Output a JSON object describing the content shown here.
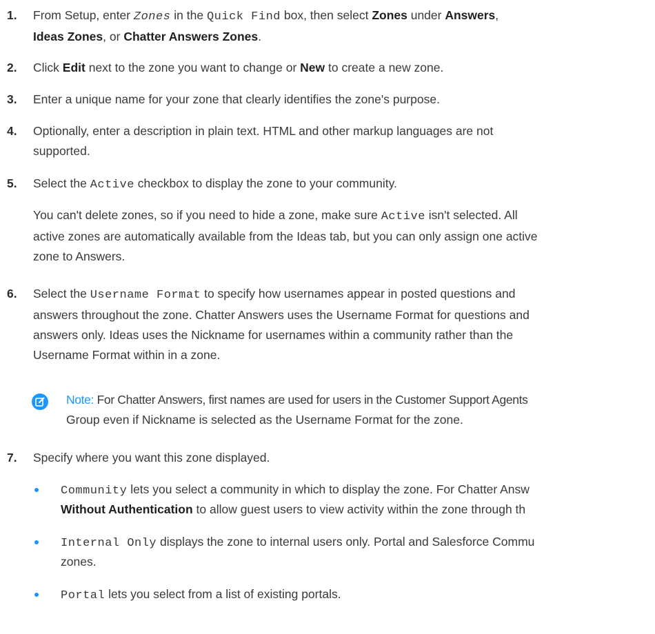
{
  "steps": [
    {
      "num": "1.",
      "t1": "From Setup, enter ",
      "c1": "Zones",
      "t2": " in the ",
      "c2": "Quick Find",
      "t3": " box, then select ",
      "b1": "Zones",
      "t4": " under ",
      "b2": "Answers",
      "t5": ",",
      "b3": "Ideas Zones",
      "t6": ", or ",
      "b4": "Chatter Answers Zones",
      "t7": "."
    },
    {
      "num": "2.",
      "t1": "Click ",
      "b1": "Edit",
      "t2": " next to the zone you want to change or ",
      "b2": "New",
      "t3": " to create a new zone."
    },
    {
      "num": "3.",
      "text": "Enter a unique name for your zone that clearly identifies the zone's purpose."
    },
    {
      "num": "4.",
      "line1": "Optionally, enter a description in plain text. HTML and other markup languages are not",
      "line2": "supported."
    },
    {
      "num": "5.",
      "t1": "Select the ",
      "c1": "Active",
      "t2": " checkbox to display the zone to your community.",
      "p1": "You can't delete zones, so if you need to hide a zone, make sure ",
      "pc": "Active",
      "p2": " isn't selected. All",
      "p3": "active zones are automatically available from the Ideas tab, but you can only assign one active",
      "p4": "zone to Answers."
    },
    {
      "num": "6.",
      "t1": "Select the ",
      "c1": "Username Format",
      "t2": " to specify how usernames appear in posted questions and",
      "l2": "answers throughout the zone. Chatter Answers uses the Username Format for questions and",
      "l3": "answers only. Ideas uses the Nickname for usernames within a community rather than the",
      "l4": "Username Format within in a zone."
    },
    {
      "num": "7.",
      "text": "Specify where you want this zone displayed."
    }
  ],
  "note": {
    "icon": "edit-note-icon",
    "label": "Note:",
    "line1": " For Chatter Answers, first names are used for users in the Customer Support Agents",
    "line2": "Group even if Nickname is selected as the Username Format for the zone.",
    "accent_color": "#1b96ff"
  },
  "bullets": [
    {
      "code": "Community",
      "text": " lets you select a community in which to display the zone. For Chatter Answ",
      "bold_line2": "Without Authentication",
      "line2": " to allow guest users to view activity within the zone through th"
    },
    {
      "code": "Internal Only",
      "text": " displays the zone to internal users only. Portal and Salesforce Commu",
      "line2": "zones."
    },
    {
      "code": "Portal",
      "text": " lets you select from a list of existing portals."
    }
  ]
}
